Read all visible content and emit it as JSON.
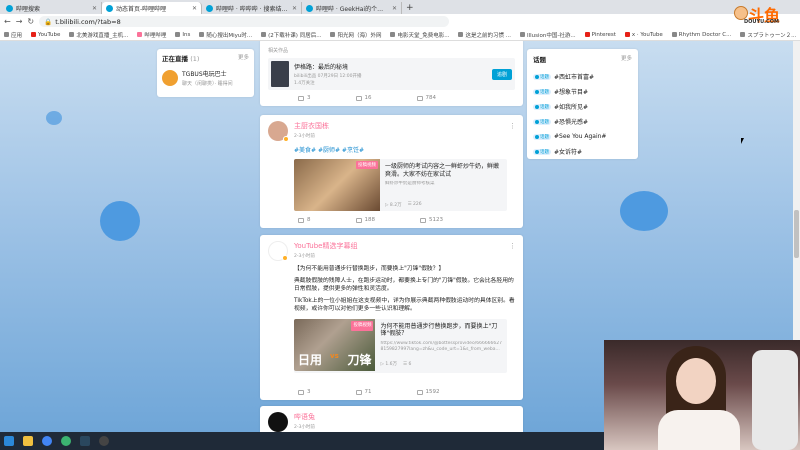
{
  "browser": {
    "tabs": [
      {
        "label": "哔哩搜索",
        "active": false
      },
      {
        "label": "动态首页-哔哩哔哩",
        "active": true
      },
      {
        "label": "哔哩哔 · 哔哔哔 · 搜索结果_哔哩哔",
        "active": false
      },
      {
        "label": "哔哩哔 · GeekHai的个人空间_哔",
        "active": false
      }
    ],
    "url": "t.bilibili.com/?tab=8",
    "bookmarks": [
      {
        "label": "应用",
        "cls": "gray"
      },
      {
        "label": "YouTube",
        "cls": "red"
      },
      {
        "label": "北美游戏直播_主机...",
        "cls": "gray"
      },
      {
        "label": "哔哩哔哩",
        "cls": "pink"
      },
      {
        "label": "Ins",
        "cls": "gray"
      },
      {
        "label": "随心搜出Miyu时...",
        "cls": "gray"
      },
      {
        "label": "(2下载补课) 同居后...",
        "cls": "gray"
      },
      {
        "label": "阳光网（海）外网",
        "cls": "gray"
      },
      {
        "label": "电影天堂_免费电影...",
        "cls": "gray"
      },
      {
        "label": "这是之前的习惯 ...",
        "cls": "gray"
      },
      {
        "label": "Illusion中国-社游...",
        "cls": "gray"
      },
      {
        "label": "Pinterest",
        "cls": "red"
      },
      {
        "label": "x · YouTube",
        "cls": "red"
      },
      {
        "label": "Rhythm Doctor C...",
        "cls": "gray"
      },
      {
        "label": "スプラトゥーン２...",
        "cls": "gray"
      },
      {
        "label": "阅读清单",
        "cls": "blue"
      }
    ],
    "logo_text": "斗鱼",
    "logo_sub": "DOUYU.COM"
  },
  "live": {
    "title": "正在直播",
    "count": "(1)",
    "more": "更多",
    "name": "TGBUS电玩巴士",
    "sub": "聊天（闲聊类）· 睡得间"
  },
  "topics": {
    "title": "话题",
    "more": "更多",
    "tag": "话题",
    "items": [
      "#西虹市首富#",
      "#想象节目#",
      "#如我所见#",
      "#恐惧光感#",
      "#See You Again#",
      "#女诉符#"
    ]
  },
  "posts": [
    {
      "tag": "相关作品",
      "embed_title": "伊格路：最后的秘境",
      "embed_meta": "bilibili出品 07月29日 12:00开播",
      "embed_count": "1.4万关注",
      "embed_button": "追剧",
      "likes": "3",
      "comments": "16",
      "shares": "784"
    },
    {
      "author": "主厨衣国栋",
      "time": "2-3小时前",
      "hashes": "#美食# #厨师# #烹饪#",
      "badge": "投稿视频",
      "title": "一级厨师的考试内容之一鲜虾炒牛奶，鲜嫩爽滑。大家不妨在家试试",
      "desc": "鲜虾炒牛奶是厨师考核菜",
      "views": "8.2万",
      "danmaku": "226",
      "likes": "8",
      "comments": "188",
      "shares": "5123"
    },
    {
      "author": "YouTube精选字幕组",
      "time": "2-3小时前",
      "p1": "【为何不能用普通步行替换跑步，而要换上\"刀锋\"假肢？】",
      "p2": "典截肢假肢的残障人士，在跑步运动时，都要换上专门的\"刀锋\"假肢。它会比各胫用的日常假肢，提供更多的弹性和灵活度。",
      "p3": "TikTok上的一位小姐姐在这支视频中，详为你展示典截两种假肢运动时的具体区别。看视频，或许你可以对他们更多一些认识和理解。",
      "badge": "投稿视频",
      "cover_left": "日用",
      "cover_vs": "vs",
      "cover_right": "刀锋",
      "title": "为何不能用普通步行替换跑步，而要换上\"刀锋\"假肢？",
      "desc": "https://www.tiktok.com/@bottessprovideo/666666627 8159827997lang=zh&u_code_urt=1&s_from_weba...",
      "views": "1.6万",
      "danmaku": "6",
      "likes": "3",
      "comments": "71",
      "shares": "1592"
    },
    {
      "author": "哔语兔",
      "time": "2-3小时前"
    }
  ]
}
